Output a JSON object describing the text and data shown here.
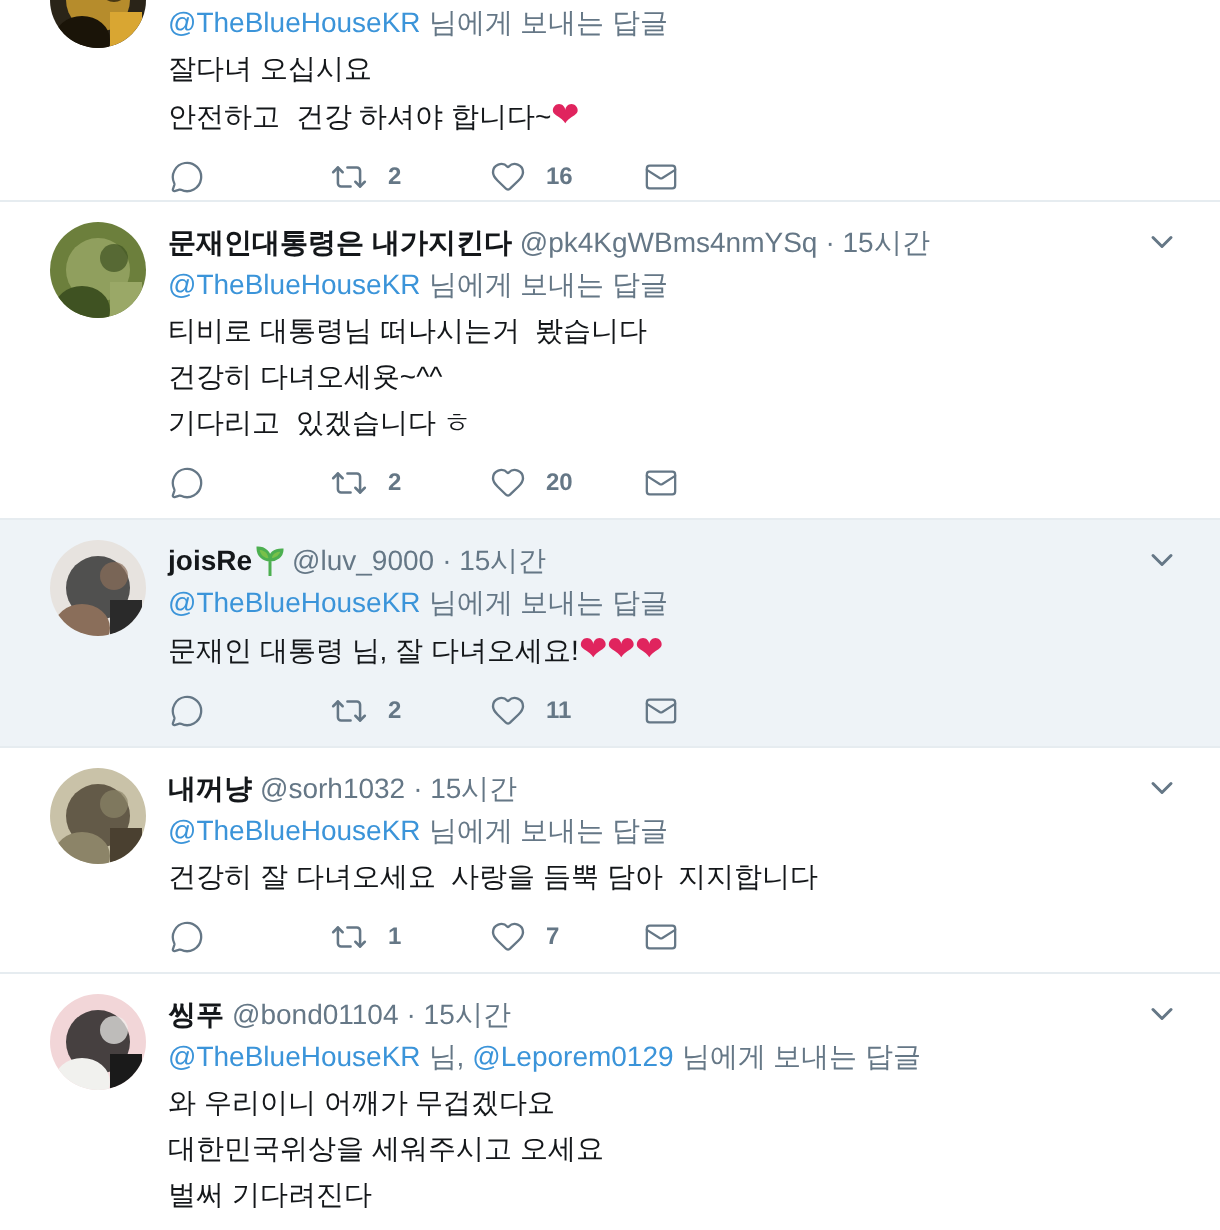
{
  "replies": [
    {
      "reply_to": [
        {
          "kind": "mention",
          "text": "@TheBlueHouseKR"
        },
        {
          "kind": "plain",
          "text": "님에게 보내는 답글"
        }
      ],
      "lines": [
        "잘다녀 오십시요",
        "안전하고  건강 하셔야 합니다~❤"
      ],
      "retweets": "2",
      "likes": "16",
      "highlighted": false
    },
    {
      "name": "문재인대통령은 내가지킨다",
      "handle": "@pk4KgWBms4nmYSq",
      "time": "· 15시간",
      "reply_to": [
        {
          "kind": "mention",
          "text": "@TheBlueHouseKR"
        },
        {
          "kind": "plain",
          "text": "님에게 보내는 답글"
        }
      ],
      "lines": [
        "티비로 대통령님 떠나시는거  봤습니다",
        "건강히 다녀오세욧~^^",
        "기다리고  있겠습니다 ㅎ"
      ],
      "retweets": "2",
      "likes": "20",
      "highlighted": false
    },
    {
      "name": "joisRe",
      "sprout": true,
      "handle": "@luv_9000",
      "time": "· 15시간",
      "reply_to": [
        {
          "kind": "mention",
          "text": "@TheBlueHouseKR"
        },
        {
          "kind": "plain",
          "text": "님에게 보내는 답글"
        }
      ],
      "lines": [
        "문재인 대통령 님, 잘 다녀오세요!❤❤❤"
      ],
      "retweets": "2",
      "likes": "11",
      "highlighted": true
    },
    {
      "name": "내꺼냥",
      "handle": "@sorh1032",
      "time": "· 15시간",
      "reply_to": [
        {
          "kind": "mention",
          "text": "@TheBlueHouseKR"
        },
        {
          "kind": "plain",
          "text": "님에게 보내는 답글"
        }
      ],
      "lines": [
        "건강히 잘 다녀오세요  사랑을 듬뿍 담아  지지합니다"
      ],
      "retweets": "1",
      "likes": "7",
      "highlighted": false
    },
    {
      "name": "씽푸",
      "handle": "@bond01104",
      "time": "· 15시간",
      "reply_to": [
        {
          "kind": "mention",
          "text": "@TheBlueHouseKR"
        },
        {
          "kind": "plain",
          "text": "님,"
        },
        {
          "kind": "mention",
          "text": "@Leporem0129"
        },
        {
          "kind": "plain",
          "text": "님에게 보내는 답글"
        }
      ],
      "lines": [
        "와 우리이니 어깨가 무겁겠다요",
        "대한민국위상을 세워주시고 오세요",
        "벌써 기다려진다"
      ],
      "highlighted": false
    }
  ]
}
